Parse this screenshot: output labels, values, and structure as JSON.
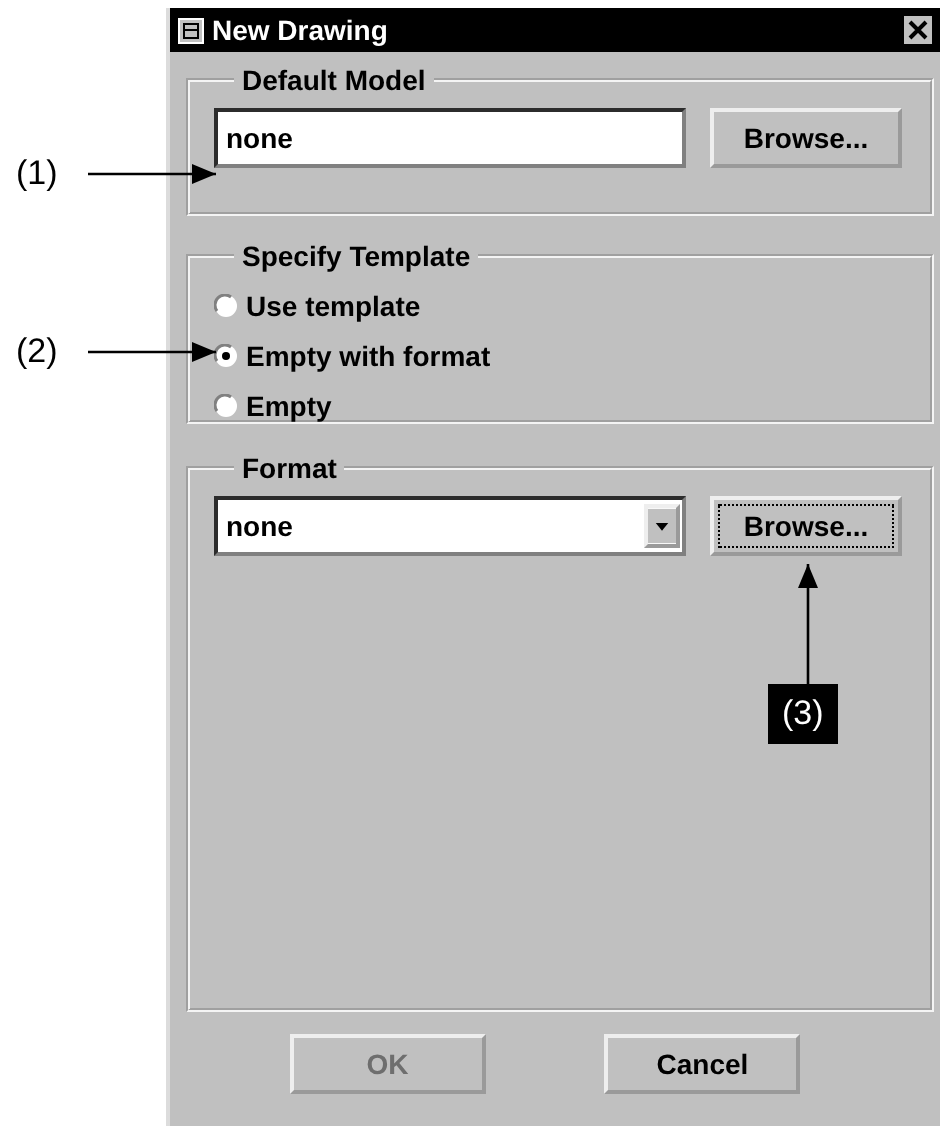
{
  "window": {
    "title": "New Drawing"
  },
  "default_model": {
    "label": "Default Model",
    "value": "none",
    "browse": {
      "label": "Browse...",
      "focused": false
    }
  },
  "template": {
    "label": "Specify Template",
    "options": [
      {
        "label": "Use template",
        "selected": false
      },
      {
        "label": "Empty with format",
        "selected": true
      },
      {
        "label": "Empty",
        "selected": false
      }
    ]
  },
  "format": {
    "label": "Format",
    "value": "none",
    "browse": {
      "label": "Browse...",
      "focused": true
    }
  },
  "buttons": [
    {
      "label": "OK",
      "disabled": true
    },
    {
      "label": "Cancel",
      "disabled": false
    }
  ],
  "annotations": [
    {
      "label": "(1)",
      "kind": "plain"
    },
    {
      "label": "(2)",
      "kind": "plain"
    },
    {
      "label": "(3)",
      "kind": "boxed"
    }
  ]
}
